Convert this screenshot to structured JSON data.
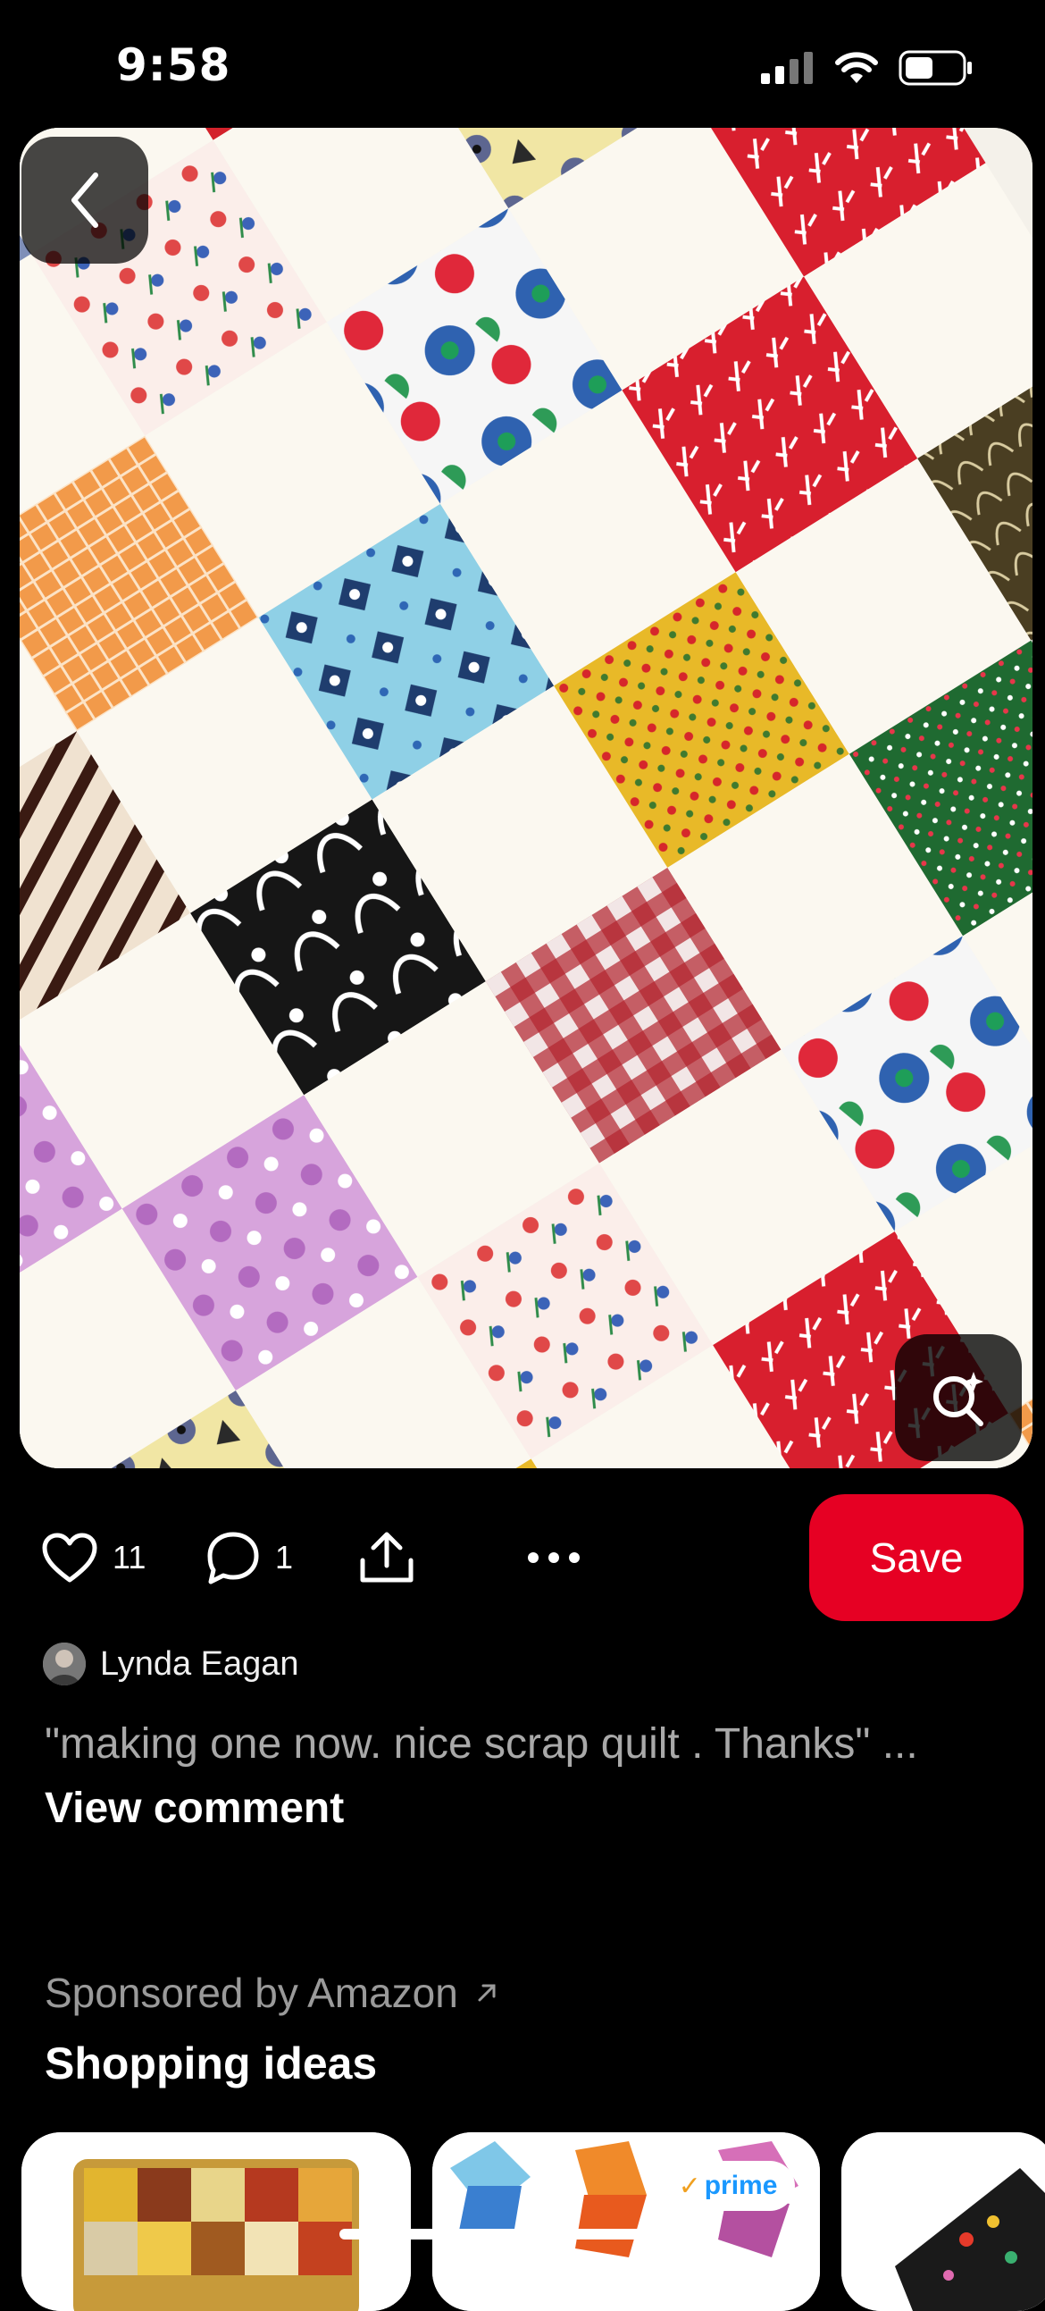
{
  "status_bar": {
    "time": "9:58"
  },
  "pin": {
    "back_icon": "chevron-left-icon",
    "lens_icon": "visual-search-icon"
  },
  "actions": {
    "likes_count": "11",
    "comments_count": "1",
    "save_label": "Save"
  },
  "comment": {
    "author": "Lynda Eagan",
    "text": "\"making one now. nice scrap quilt . Thanks\" ...",
    "view_label": "View comment"
  },
  "sponsored": {
    "label": "Sponsored by Amazon",
    "title": "Shopping ideas",
    "prime_badge": "prime"
  },
  "colors": {
    "save": "#e60023",
    "background": "#000000",
    "muted_text": "#a9a9a9"
  }
}
